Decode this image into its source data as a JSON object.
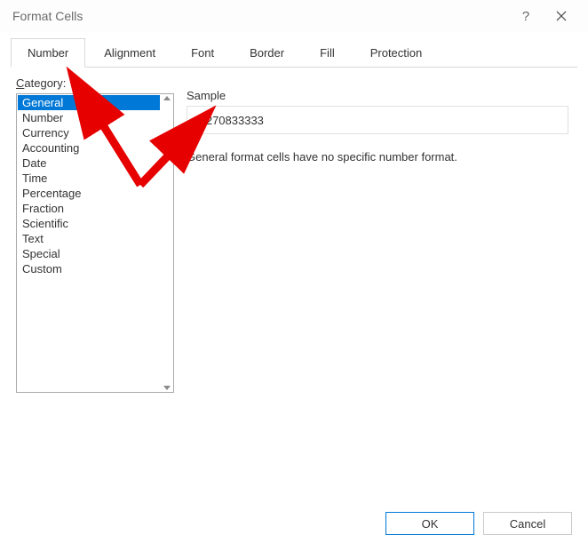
{
  "titlebar": {
    "title": "Format Cells"
  },
  "tabs": [
    {
      "label": "Number",
      "active": true
    },
    {
      "label": "Alignment",
      "active": false
    },
    {
      "label": "Font",
      "active": false
    },
    {
      "label": "Border",
      "active": false
    },
    {
      "label": "Fill",
      "active": false
    },
    {
      "label": "Protection",
      "active": false
    }
  ],
  "category": {
    "label_prefix": "C",
    "label_rest": "ategory:",
    "items": [
      {
        "label": "General",
        "selected": true
      },
      {
        "label": "Number",
        "selected": false
      },
      {
        "label": "Currency",
        "selected": false
      },
      {
        "label": "Accounting",
        "selected": false
      },
      {
        "label": "Date",
        "selected": false
      },
      {
        "label": "Time",
        "selected": false
      },
      {
        "label": "Percentage",
        "selected": false
      },
      {
        "label": "Fraction",
        "selected": false
      },
      {
        "label": "Scientific",
        "selected": false
      },
      {
        "label": "Text",
        "selected": false
      },
      {
        "label": "Special",
        "selected": false
      },
      {
        "label": "Custom",
        "selected": false
      }
    ]
  },
  "sample": {
    "label": "Sample",
    "value": "0.270833333"
  },
  "description": "General format cells have no specific number format.",
  "buttons": {
    "ok": "OK",
    "cancel": "Cancel"
  }
}
